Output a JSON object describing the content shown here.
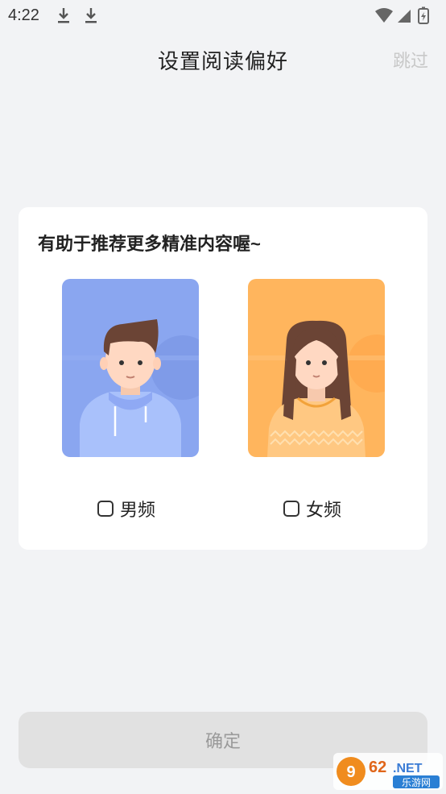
{
  "status_bar": {
    "time": "4:22"
  },
  "header": {
    "title": "设置阅读偏好",
    "skip_label": "跳过"
  },
  "card": {
    "title": "有助于推荐更多精准内容喔~",
    "options": [
      {
        "label": "男频",
        "checked": false,
        "bg_color": "#8aa6f0"
      },
      {
        "label": "女频",
        "checked": false,
        "bg_color": "#ffb55d"
      }
    ]
  },
  "confirm": {
    "label": "确定"
  },
  "watermark": {
    "brand": "962.NET",
    "sub": "乐游网"
  }
}
